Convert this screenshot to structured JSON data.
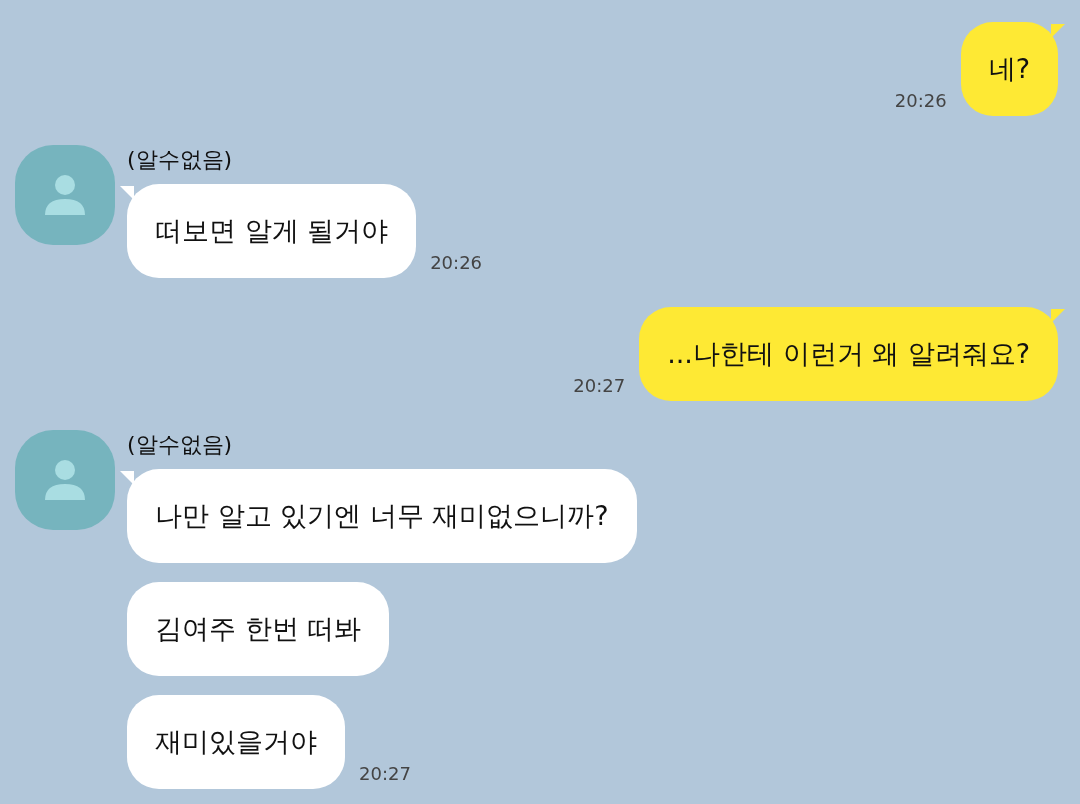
{
  "messages": [
    {
      "kind": "sent",
      "bubbles": [
        "네?"
      ],
      "time": "20:26"
    },
    {
      "kind": "received",
      "sender": "(알수없음)",
      "bubbles": [
        "떠보면 알게 될거야"
      ],
      "time": "20:26"
    },
    {
      "kind": "sent",
      "bubbles": [
        "...나한테 이런거 왜 알려줘요?"
      ],
      "time": "20:27"
    },
    {
      "kind": "received",
      "sender": "(알수없음)",
      "bubbles": [
        "나만 알고 있기엔 너무 재미없으니까?",
        "김여주 한번 떠봐",
        "재미있을거야"
      ],
      "time": "20:27"
    }
  ]
}
